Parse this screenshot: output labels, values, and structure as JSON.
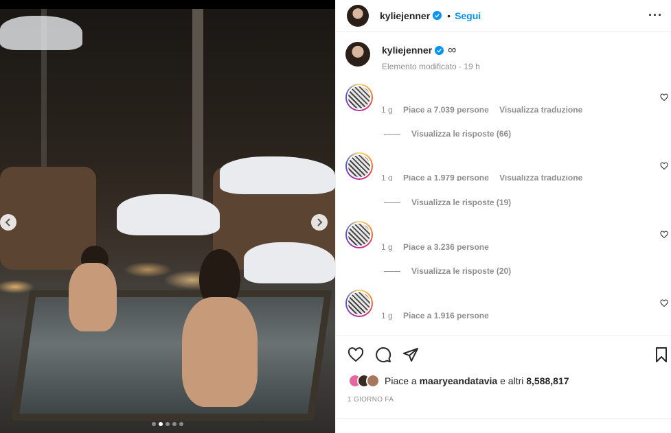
{
  "post": {
    "username": "kyliejenner",
    "follow_label": "Segui",
    "separator": "•",
    "more_label": "···"
  },
  "caption": {
    "username": "kyliejenner",
    "symbol": "∞",
    "subtitle": "Elemento modificato · 19 h"
  },
  "comments": [
    {
      "age": "1 g",
      "likes": "Piace a 7.039 persone",
      "extra": "Visualizza traduzione",
      "replies": "Visualizza le risposte (66)"
    },
    {
      "age": "1 g",
      "likes": "Piace a 1.979 persone",
      "extra": "Visualizza traduzione",
      "replies": "Visualizza le risposte (19)"
    },
    {
      "age": "1 g",
      "likes": "Piace a 3.236 persone",
      "extra": "",
      "replies": "Visualizza le risposte (20)"
    },
    {
      "age": "1 g",
      "likes": "Piace a 1.916 persone",
      "extra": "",
      "replies": ""
    }
  ],
  "likes": {
    "prefix": "Piace a",
    "user": "maaryeandatavia",
    "middle": "e altri",
    "count": "8,588,817"
  },
  "date": "1 GIORNO FA",
  "carousel": {
    "slides": 5,
    "active_index": 1
  },
  "colors": {
    "accent": "#0095f6",
    "text": "#262626",
    "muted": "#8e8e8e",
    "divider": "#efefef"
  },
  "icons": [
    "verified-icon",
    "more-icon",
    "heart-icon",
    "comment-icon",
    "share-icon",
    "bookmark-icon",
    "chevron-left-icon",
    "chevron-right-icon"
  ]
}
